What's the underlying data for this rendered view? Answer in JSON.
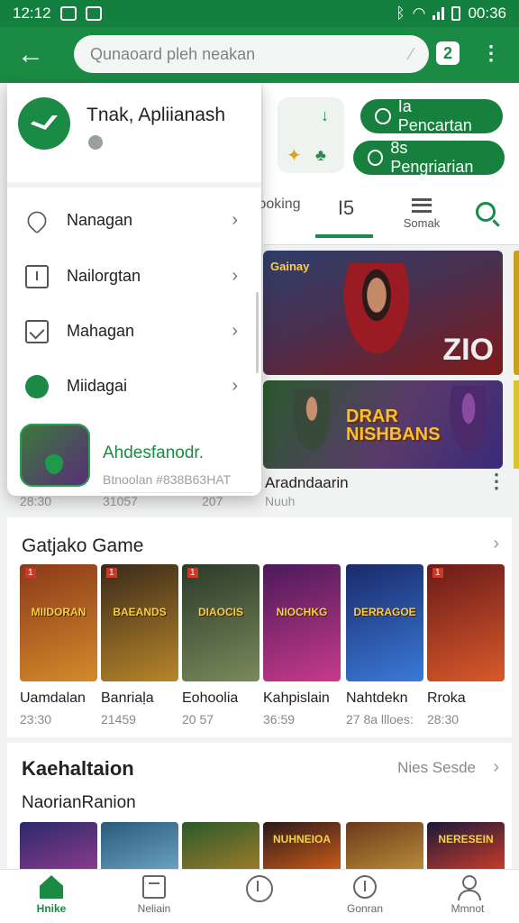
{
  "status_bar": {
    "time_left": "12:12",
    "time_right": "00:36"
  },
  "app_bar": {
    "search_text": "Qunaoard pleh neakan",
    "square_label": "2"
  },
  "top_card": {
    "pill1_label": "Ia Pencartan",
    "pill2_label": "8s Pengriarian"
  },
  "tabs": {
    "tab0": "ooking",
    "tab1": "I5",
    "tab2": "Somak"
  },
  "hero": {
    "tag": "Gainay",
    "number": "ZIO"
  },
  "card2": {
    "title_line1": "DRAR",
    "title_line2": "NISHBANS"
  },
  "behind_meta": {
    "title": "Aradndaarin",
    "subtitle": "Nuuh",
    "n1": "28:30",
    "n2": "31057",
    "n3": "207"
  },
  "drawer": {
    "title": "Tnak, Apliianash",
    "items": [
      {
        "label": "Nanagan",
        "icon": "heart-icon"
      },
      {
        "label": "Nailorgtan",
        "icon": "info-icon"
      },
      {
        "label": "Mahagan",
        "icon": "checklist-icon"
      },
      {
        "label": "Miidagai",
        "icon": "chat-icon"
      }
    ],
    "featured": {
      "title": "Ahdesfanodr.",
      "subtitle": "Btnoolan #838B63HAT"
    }
  },
  "section1": {
    "title": "Gatjako Game",
    "games": [
      {
        "badge": "1",
        "tile_label": "MIIDORAN",
        "name": "Uamdalan",
        "value": "23:30",
        "colors": [
          "#8a3a1a",
          "#d48a2a"
        ]
      },
      {
        "badge": "1",
        "tile_label": "BAEANDS",
        "name": "Banriaḷa",
        "value": "21459",
        "colors": [
          "#3a2a1a",
          "#b8862a"
        ]
      },
      {
        "badge": "1",
        "tile_label": "DIAOCIS",
        "name": "Eohoolia",
        "value": "20 57",
        "colors": [
          "#2a3a2a",
          "#7a8a5a"
        ]
      },
      {
        "badge": "",
        "tile_label": "NIOCHKG",
        "name": "Kahpislain",
        "value": "36:59",
        "colors": [
          "#4a1a5a",
          "#c83a8a"
        ]
      },
      {
        "badge": "",
        "tile_label": "DERRAGOE",
        "name": "Nahtdekn",
        "value": "27 8a llloes:",
        "colors": [
          "#1a2a6a",
          "#3a7ad8"
        ]
      },
      {
        "badge": "1",
        "tile_label": "",
        "name": "Rroka",
        "value": "28:30",
        "colors": [
          "#6a1a1a",
          "#d85a2a"
        ]
      }
    ]
  },
  "section2": {
    "title": "Kaehaltaion",
    "link": "Nies Sesde",
    "subtitle": "NaorianRanion",
    "tiles": [
      {
        "label": "",
        "colors": [
          "#2a2a6a",
          "#8a3a8a"
        ]
      },
      {
        "label": "",
        "colors": [
          "#2a5a7a",
          "#6aa0c0"
        ]
      },
      {
        "label": "",
        "colors": [
          "#2a5a2a",
          "#9a7a2a"
        ]
      },
      {
        "label": "NUHNEIOA",
        "colors": [
          "#2a1a1a",
          "#c85a1a"
        ]
      },
      {
        "label": "",
        "colors": [
          "#6a3a1a",
          "#b88a3a"
        ]
      },
      {
        "label": "NERESEIN",
        "colors": [
          "#1a1a3a",
          "#c83a2a"
        ]
      }
    ]
  },
  "bottom_nav": [
    {
      "label": "Hnike",
      "active": true
    },
    {
      "label": "Neliain",
      "active": false
    },
    {
      "label": "",
      "active": false
    },
    {
      "label": "Gonran",
      "active": false
    },
    {
      "label": "Mmnot",
      "active": false
    }
  ]
}
